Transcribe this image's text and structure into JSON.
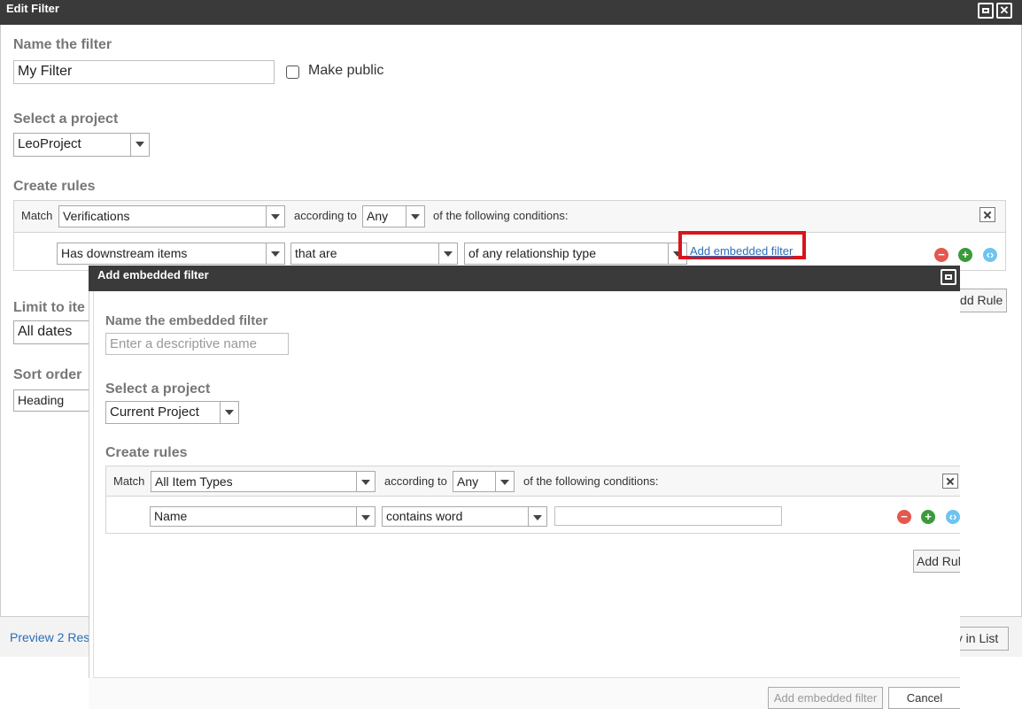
{
  "main": {
    "title": "Edit Filter",
    "name_label": "Name the filter",
    "name_value": "My Filter",
    "make_public": "Make public",
    "project_label": "Select a project",
    "project_value": "LeoProject",
    "rules_label": "Create rules",
    "match": "Match",
    "match_value": "Verifications",
    "according_to": "according to",
    "any_value": "Any",
    "following": "of the following conditions:",
    "rule": {
      "field": "Has downstream items",
      "operator": "that are",
      "relationship": "of any relationship type"
    },
    "add_embedded_link": "Add embedded filter",
    "add_rule": "Add Rule",
    "limit_label": "Limit to ite",
    "limit_value": "All dates",
    "sort_label": "Sort order",
    "sort_value": "Heading",
    "preview_link": "Preview 2 Res",
    "view_in_list": "y in List"
  },
  "embedded": {
    "title": "Add embedded filter",
    "name_label": "Name the embedded filter",
    "name_placeholder": "Enter a descriptive name",
    "project_label": "Select a project",
    "project_value": "Current Project",
    "rules_label": "Create rules",
    "match": "Match",
    "match_value": "All Item Types",
    "according_to": "according to",
    "any_value": "Any",
    "following": "of the following conditions:",
    "rule": {
      "field": "Name",
      "operator": "contains word",
      "value": ""
    },
    "add_rule": "Add Rul",
    "add_embedded_button": "Add embedded filter",
    "cancel_button": "Cancel"
  },
  "colors": {
    "titlebar": "#3a3a3a",
    "highlight": "#d9141c",
    "link": "#2a6ebb",
    "remove": "#e4584f",
    "add": "#3a9a3a",
    "embed": "#6ec4ef"
  },
  "icons": {
    "maximize": "maximize-icon",
    "close": "close-icon",
    "remove_rule": "minus-circle-icon",
    "add_rule": "plus-circle-icon",
    "embed_rule": "embed-circle-icon"
  }
}
